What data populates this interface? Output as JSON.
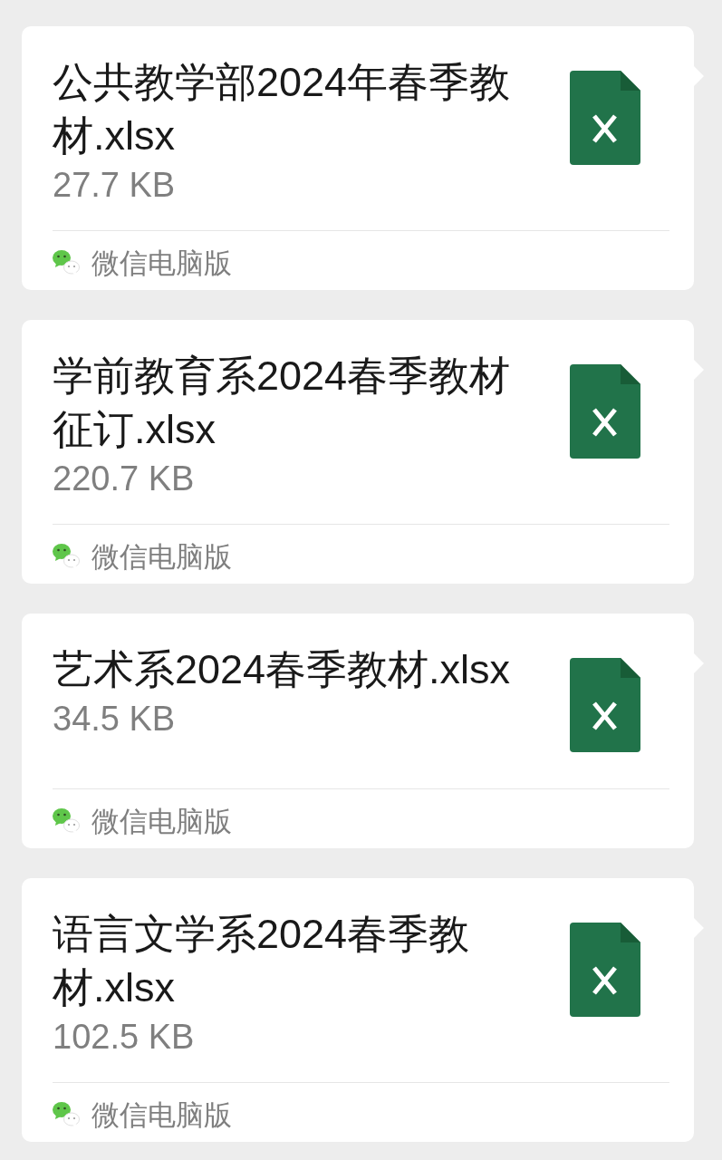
{
  "messages": [
    {
      "kind": "xlsx",
      "outgoing": true,
      "file_name": "公共教学部2024年春季教材.xlsx",
      "file_size": "27.7 KB",
      "source": "微信电脑版"
    },
    {
      "kind": "xlsx",
      "outgoing": true,
      "file_name": "学前教育系2024春季教材征订.xlsx",
      "file_size": "220.7 KB",
      "source": "微信电脑版"
    },
    {
      "kind": "xlsx",
      "outgoing": true,
      "file_name": "艺术系2024春季教材.xlsx",
      "file_size": "34.5 KB",
      "source": "微信电脑版"
    },
    {
      "kind": "xlsx",
      "outgoing": true,
      "file_name": "语言文学系2024春季教材.xlsx",
      "file_size": "102.5 KB",
      "source": "微信电脑版"
    }
  ]
}
